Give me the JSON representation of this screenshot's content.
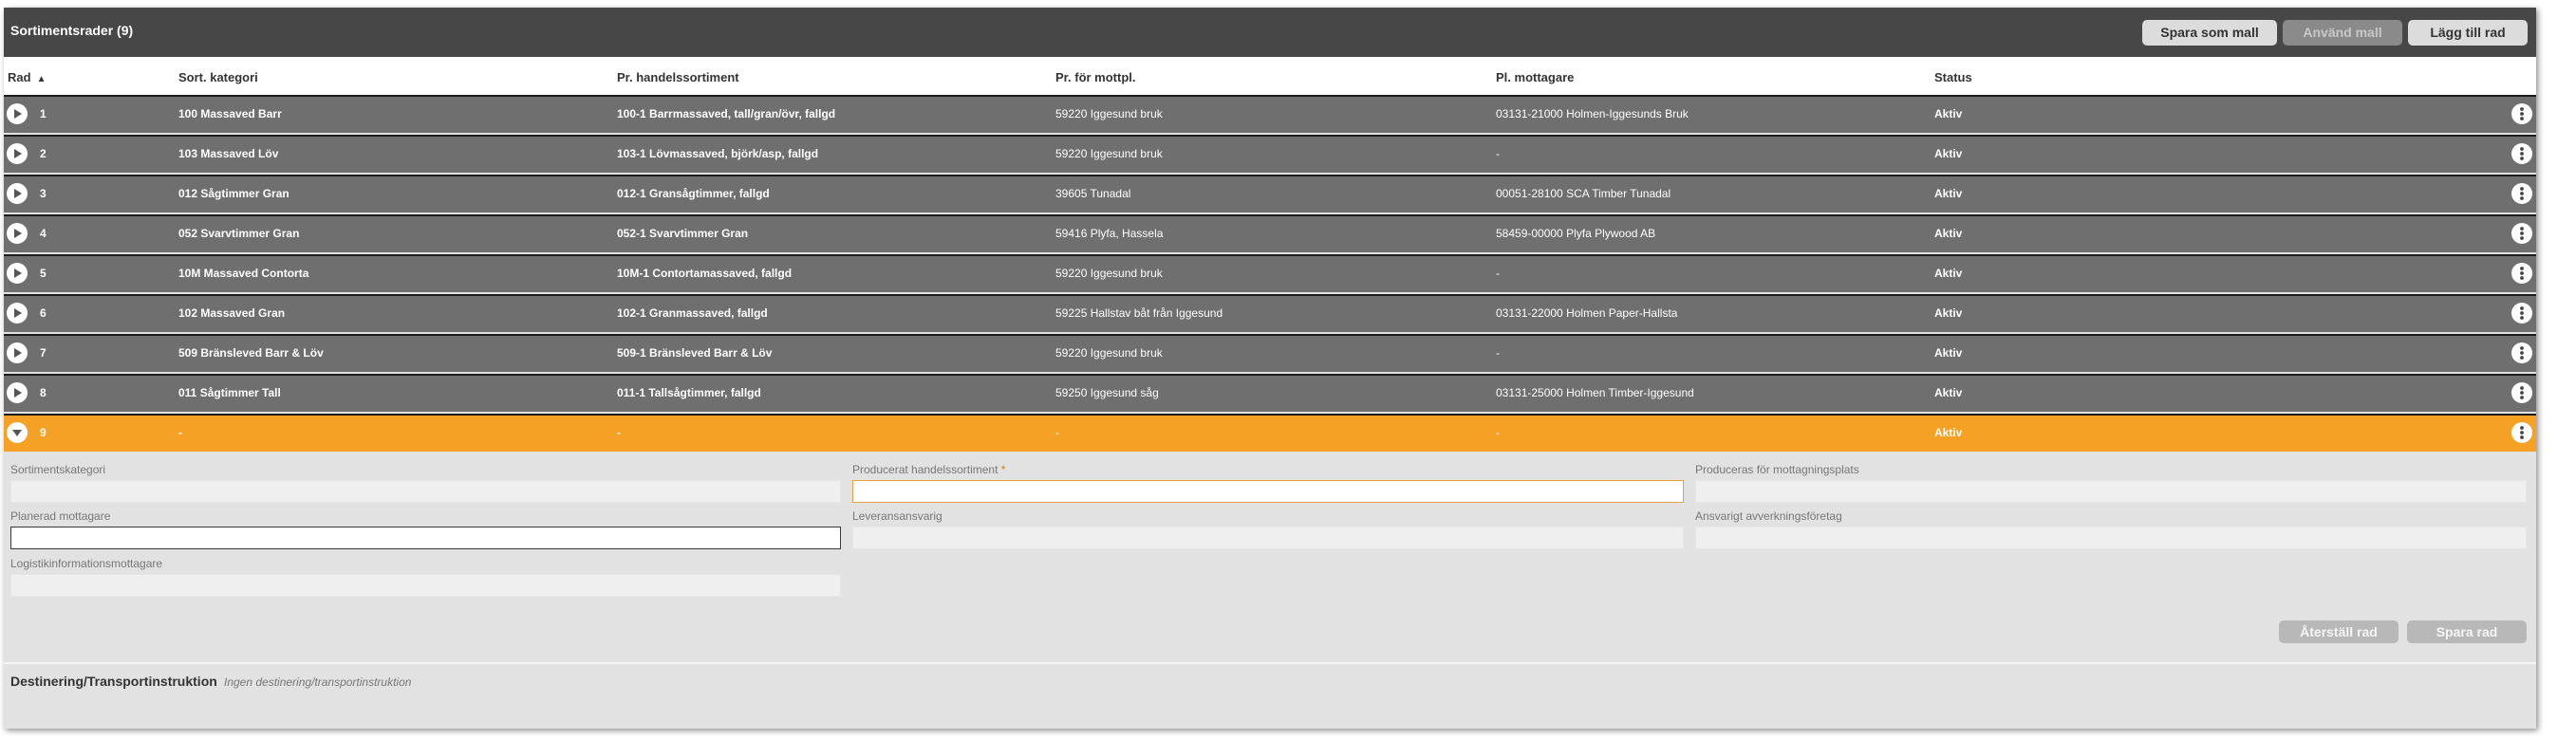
{
  "header": {
    "title": "Sortimentsrader (9)",
    "buttons": {
      "save_template": "Spara som mall",
      "use_template": "Använd mall",
      "add_row": "Lägg till rad"
    }
  },
  "columns": {
    "rad": "Rad",
    "kategori": "Sort. kategori",
    "handelssortiment": "Pr. handelssortiment",
    "mottpl": "Pr. för mottpl.",
    "mottagare": "Pl. mottagare",
    "status": "Status",
    "sort_icon": "sort-ascending-icon"
  },
  "rows": [
    {
      "rad": "1",
      "kategori": "100 Massaved Barr",
      "handelssortiment": "100-1 Barrmassaved, tall/gran/övr, fallgd",
      "mottpl": "59220 Iggesund bruk",
      "mottagare": "03131-21000 Holmen-Iggesunds Bruk",
      "status": "Aktiv"
    },
    {
      "rad": "2",
      "kategori": "103 Massaved Löv",
      "handelssortiment": "103-1 Lövmassaved, björk/asp, fallgd",
      "mottpl": "59220 Iggesund bruk",
      "mottagare": "-",
      "status": "Aktiv"
    },
    {
      "rad": "3",
      "kategori": "012 Sågtimmer Gran",
      "handelssortiment": "012-1 Gransågtimmer, fallgd",
      "mottpl": "39605 Tunadal",
      "mottagare": "00051-28100 SCA Timber Tunadal",
      "status": "Aktiv"
    },
    {
      "rad": "4",
      "kategori": "052 Svarvtimmer Gran",
      "handelssortiment": "052-1 Svarvtimmer Gran",
      "mottpl": "59416 Plyfa, Hassela",
      "mottagare": "58459-00000 Plyfa Plywood AB",
      "status": "Aktiv"
    },
    {
      "rad": "5",
      "kategori": "10M Massaved Contorta",
      "handelssortiment": "10M-1 Contortamassaved, fallgd",
      "mottpl": "59220 Iggesund bruk",
      "mottagare": "-",
      "status": "Aktiv"
    },
    {
      "rad": "6",
      "kategori": "102 Massaved Gran",
      "handelssortiment": "102-1 Granmassaved, fallgd",
      "mottpl": "59225 Hallstav båt från Iggesund",
      "mottagare": "03131-22000 Holmen Paper-Hallsta",
      "status": "Aktiv"
    },
    {
      "rad": "7",
      "kategori": "509 Bränsleved Barr & Löv",
      "handelssortiment": "509-1 Bränsleved Barr & Löv",
      "mottpl": "59220 Iggesund bruk",
      "mottagare": "-",
      "status": "Aktiv"
    },
    {
      "rad": "8",
      "kategori": "011 Sågtimmer Tall",
      "handelssortiment": "011-1 Tallsågtimmer, fallgd",
      "mottpl": "59250 Iggesund såg",
      "mottagare": "03131-25000 Holmen Timber-Iggesund",
      "status": "Aktiv"
    },
    {
      "rad": "9",
      "kategori": "-",
      "handelssortiment": "-",
      "mottpl": "-",
      "mottagare": "-",
      "status": "Aktiv"
    }
  ],
  "form": {
    "sortimentskategori": {
      "label": "Sortimentskategori",
      "value": ""
    },
    "producerat_handelssortiment": {
      "label": "Producerat handelssortiment",
      "required_mark": "*",
      "value": ""
    },
    "produceras_for": {
      "label": "Produceras för mottagningsplats",
      "value": ""
    },
    "planerad_mottagare": {
      "label": "Planerad mottagare",
      "value": ""
    },
    "leveransansvarig": {
      "label": "Leveransansvarig",
      "value": ""
    },
    "ansvarigt_avverkning": {
      "label": "Ansvarigt avverkningsföretag",
      "value": ""
    },
    "logistik": {
      "label": "Logistikinformationsmottagare",
      "value": ""
    },
    "buttons": {
      "reset": "Återställ rad",
      "save": "Spara rad"
    }
  },
  "destination": {
    "title": "Destinering/Transportinstruktion",
    "note": "Ingen destinering/transportinstruktion"
  },
  "colors": {
    "header_bg": "#474747",
    "row_bg": "#6f6f6f",
    "active_row_bg": "#f5a125",
    "panel_bg": "#e2e2e2",
    "required": "#e07a10"
  }
}
